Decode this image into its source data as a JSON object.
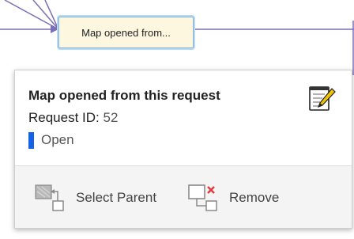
{
  "node": {
    "label": "Map opened from..."
  },
  "card": {
    "title": "Map opened from this request",
    "request_id_label": "Request ID:",
    "request_id_value": "52",
    "status": "Open",
    "status_color": "#1463e6",
    "edit_icon": "edit-note-icon"
  },
  "actions": {
    "select_parent": {
      "label": "Select Parent",
      "icon": "select-parent-icon"
    },
    "remove": {
      "label": "Remove",
      "icon": "remove-icon"
    }
  },
  "colors": {
    "edge": "#7b6fb5",
    "node_fill": "#fdf7e0",
    "node_border": "#7db2de",
    "remove_x": "#e03b3b"
  }
}
